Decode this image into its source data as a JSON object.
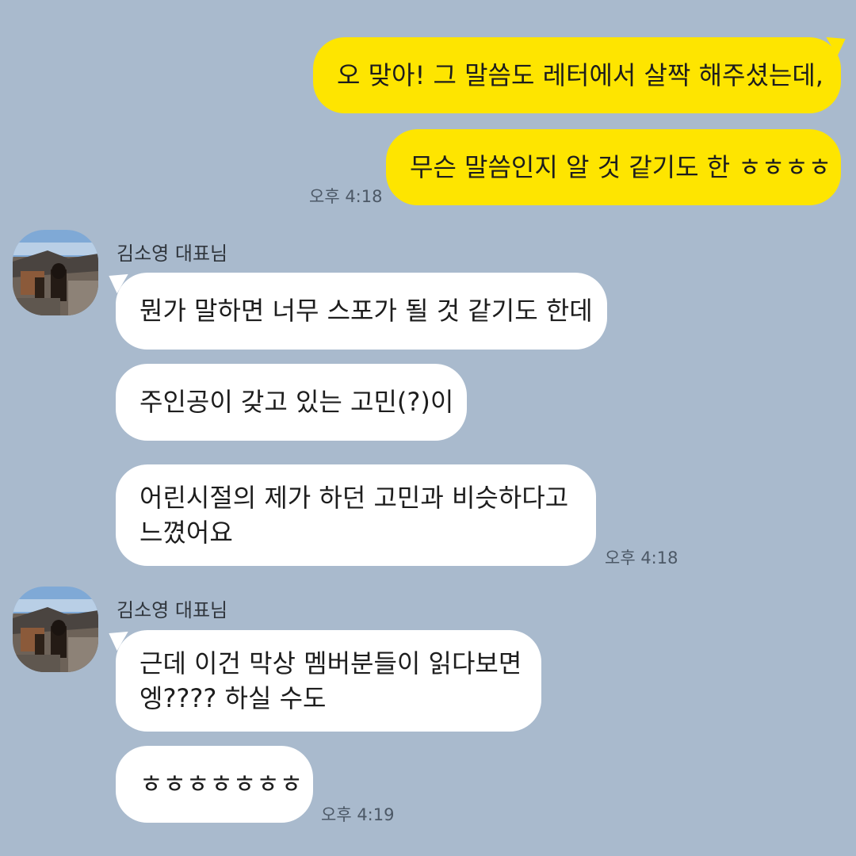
{
  "chat": {
    "my_messages": [
      "오 맞아! 그 말씀도 레터에서 살짝 해주셨는데,",
      "무슨 말씀인지 알 것 같기도 한 ㅎㅎㅎㅎ"
    ],
    "my_time": "오후 4:18",
    "group1": {
      "sender": "김소영 대표님",
      "messages": [
        "뭔가 말하면 너무 스포가 될 것 같기도 한데",
        "주인공이 갖고 있는 고민(?)이",
        "어린시절의 제가 하던 고민과 비슷하다고",
        "느꼈어요"
      ],
      "time": "오후 4:18"
    },
    "group2": {
      "sender": "김소영 대표님",
      "messages": [
        "근데 이건 막상 멤버분들이 읽다보면",
        "엥???? 하실 수도",
        "ㅎㅎㅎㅎㅎㅎㅎ"
      ],
      "time": "오후 4:19"
    }
  }
}
